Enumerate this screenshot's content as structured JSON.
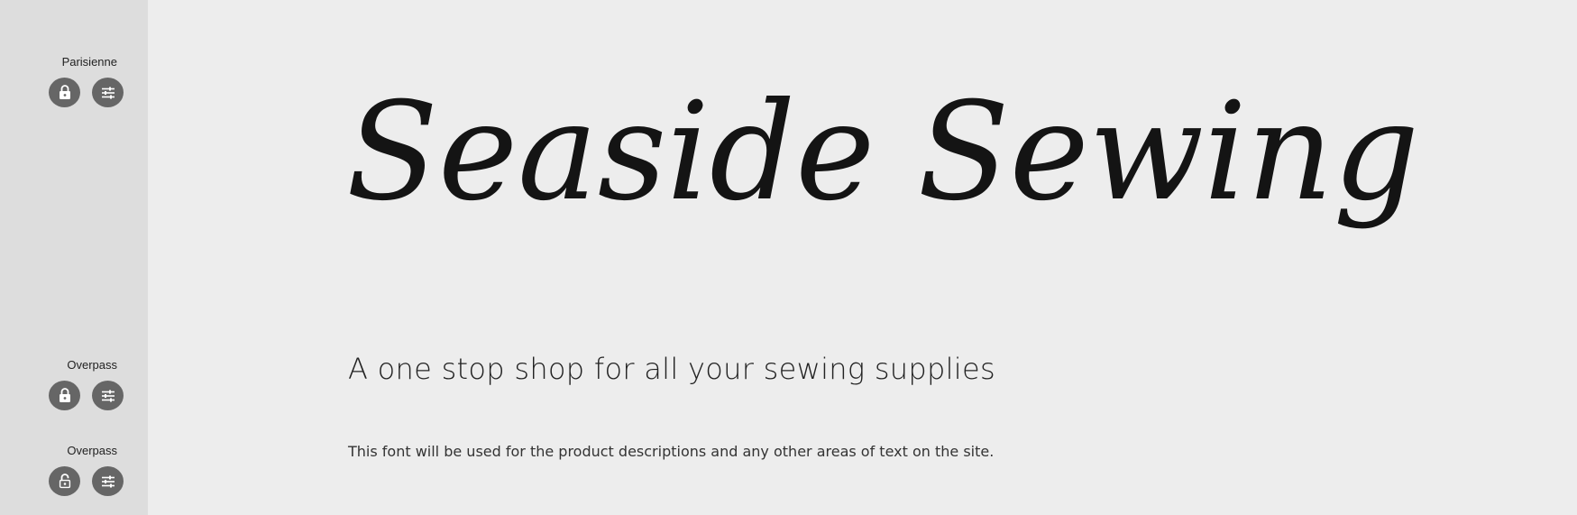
{
  "sidebar": {
    "groups": [
      {
        "font_name": "Parisienne",
        "locked": true,
        "lock_icon": "lock-closed-icon",
        "settings_icon": "sliders-icon"
      },
      {
        "font_name": "Overpass",
        "locked": true,
        "lock_icon": "lock-closed-icon",
        "settings_icon": "sliders-icon"
      },
      {
        "font_name": "Overpass",
        "locked": false,
        "lock_icon": "lock-open-icon",
        "settings_icon": "sliders-icon"
      }
    ]
  },
  "preview": {
    "heading": "Seaside Sewing",
    "tagline": "A one stop shop for all your sewing supplies",
    "body": "This font will be used for the product descriptions and any other areas of text on the site."
  },
  "colors": {
    "sidebar_bg": "#dddddd",
    "canvas_bg": "#ededed",
    "button_bg": "#666666",
    "text": "#141414"
  }
}
